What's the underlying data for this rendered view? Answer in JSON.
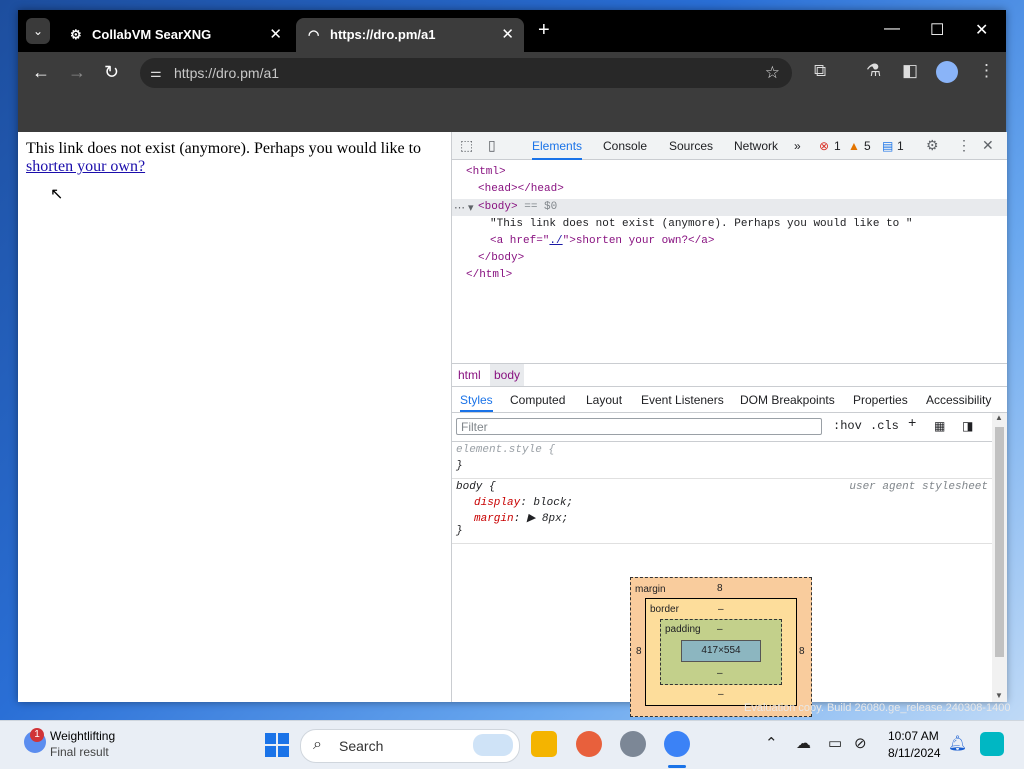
{
  "browser": {
    "tabs": [
      {
        "title": "CollabVM SearXNG",
        "active": false
      },
      {
        "title": "https://dro.pm/a1",
        "active": true
      }
    ],
    "url": "https://dro.pm/a1"
  },
  "page": {
    "text": "This link does not exist (anymore). Perhaps you would like to",
    "link": "shorten your own?"
  },
  "devtools": {
    "tabs": [
      "Elements",
      "Console",
      "Sources",
      "Network"
    ],
    "errors": "1",
    "warnings": "5",
    "messages": "1",
    "dom": {
      "html_open": "<html>",
      "head": "<head></head>",
      "body_open": "<body>",
      "body_marker": "== $0",
      "text_node": "\"This link does not exist (anymore). Perhaps you would like to \"",
      "a_open": "<a href=\"",
      "a_href": "./",
      "a_mid": "\">shorten your own?</a>",
      "body_close": "</body>",
      "html_close": "</html>"
    },
    "breadcrumbs": [
      "html",
      "body"
    ],
    "sub_tabs": [
      "Styles",
      "Computed",
      "Layout",
      "Event Listeners",
      "DOM Breakpoints",
      "Properties",
      "Accessibility"
    ],
    "filter_placeholder": "Filter",
    "hov": ":hov",
    "cls": ".cls",
    "styles": {
      "element_style": "element.style {",
      "close_brace": "}",
      "body_rule": "body {",
      "origin": "user agent stylesheet",
      "prop1": "display",
      "val1": "block;",
      "prop2": "margin",
      "val2": "8px;"
    },
    "box_model": {
      "margin_label": "margin",
      "margin_top": "8",
      "margin_left": "8",
      "margin_right": "8",
      "border_label": "border",
      "border_value": "–",
      "padding_label": "padding",
      "padding_value": "–",
      "content": "417×554"
    }
  },
  "taskbar": {
    "weather_title": "Weightlifting",
    "weather_sub": "Final result",
    "weather_badge": "1",
    "search": "Search",
    "time": "10:07 AM",
    "date": "8/11/2024"
  },
  "watermark": "Evaluation copy. Build 26080.ge_release.240308-1400"
}
